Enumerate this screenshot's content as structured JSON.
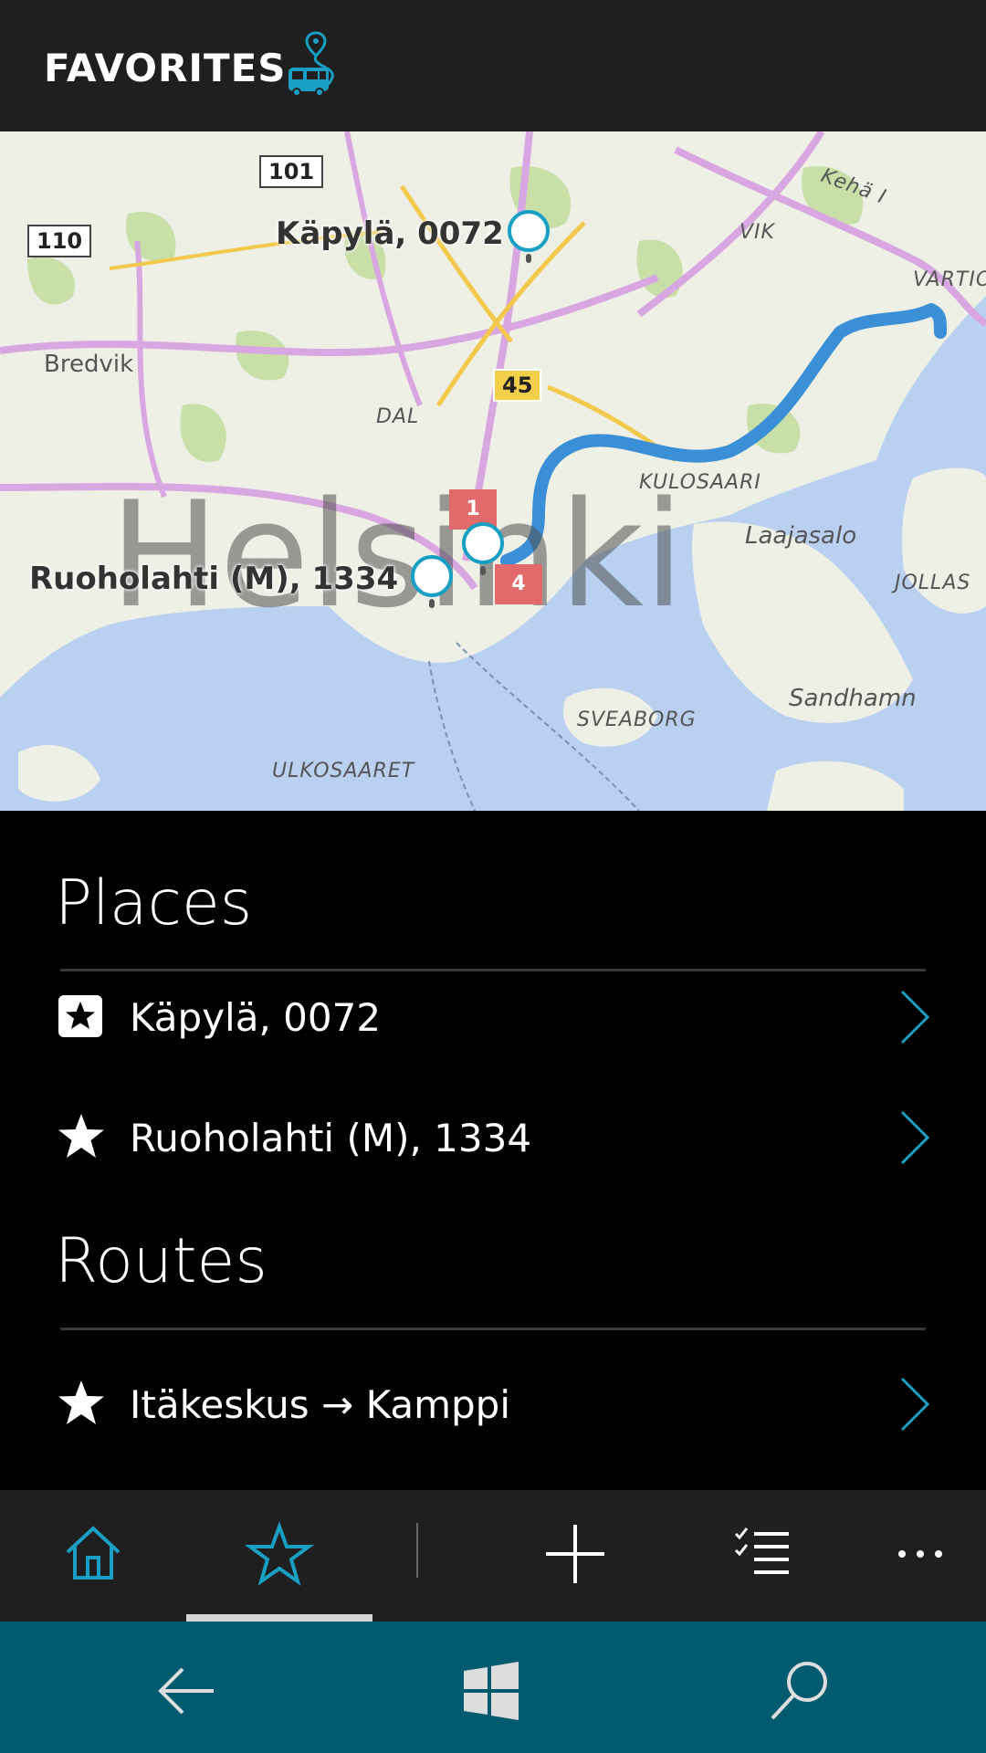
{
  "header": {
    "title": "FAVORITES"
  },
  "map": {
    "city_label": "Helsinki",
    "labels": {
      "bredvik": "Bredvik",
      "dal": "DAL",
      "vik": "VIK",
      "kulosaari": "KULOSAARI",
      "laajasalo": "Laajasalo",
      "jollas": "JOLLAS",
      "sandhamn": "Sandhamn",
      "sveaborg": "SVEABORG",
      "ulkosaaret": "ULKOSAARET",
      "keha": "Kehä I",
      "vartio": "VARTIO"
    },
    "roads": {
      "r101": "101",
      "r110": "110",
      "r45": "45"
    },
    "badges": {
      "b1": "1",
      "b4": "4"
    },
    "pins": {
      "kapyla": "Käpylä, 0072",
      "ruoholahti": "Ruoholahti (M), 1334"
    },
    "route_color": "#3a8fd6"
  },
  "places": {
    "title": "Places",
    "items": [
      {
        "label": "Käpylä, 0072",
        "icon": "star-box-icon"
      },
      {
        "label": "Ruoholahti (M), 1334",
        "icon": "star-icon"
      }
    ]
  },
  "routes": {
    "title": "Routes",
    "items": [
      {
        "label": "Itäkeskus → Kamppi",
        "icon": "star-icon"
      }
    ]
  },
  "colors": {
    "accent": "#1a9fc4",
    "navbar": "#005a70",
    "appbar": "#1f1f1f"
  }
}
